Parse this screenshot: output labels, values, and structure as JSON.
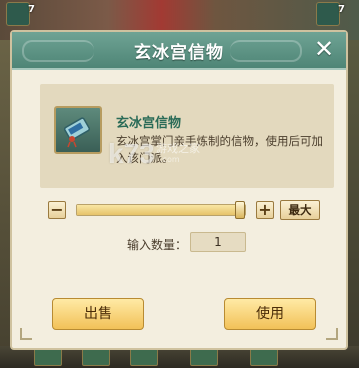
{
  "background": {
    "top_counts": [
      "7",
      "7"
    ]
  },
  "dialog": {
    "title": "玄冰宫信物",
    "close_glyph": "✕"
  },
  "item": {
    "name": "玄冰宫信物",
    "description": "玄冰宫掌门亲手炼制的信物，使用后可加入该门派。",
    "icon": "token-scroll-icon"
  },
  "quantity_selector": {
    "minus_label": "−",
    "plus_label": "+",
    "max_label": "最大",
    "slider_fraction": 1.0
  },
  "quantity": {
    "label": "输入数量：",
    "value": "1"
  },
  "actions": {
    "sell_label": "出售",
    "use_label": "使用"
  },
  "watermark": {
    "logo": "k73",
    "tagline": "游戏之家",
    "url": ".com"
  }
}
